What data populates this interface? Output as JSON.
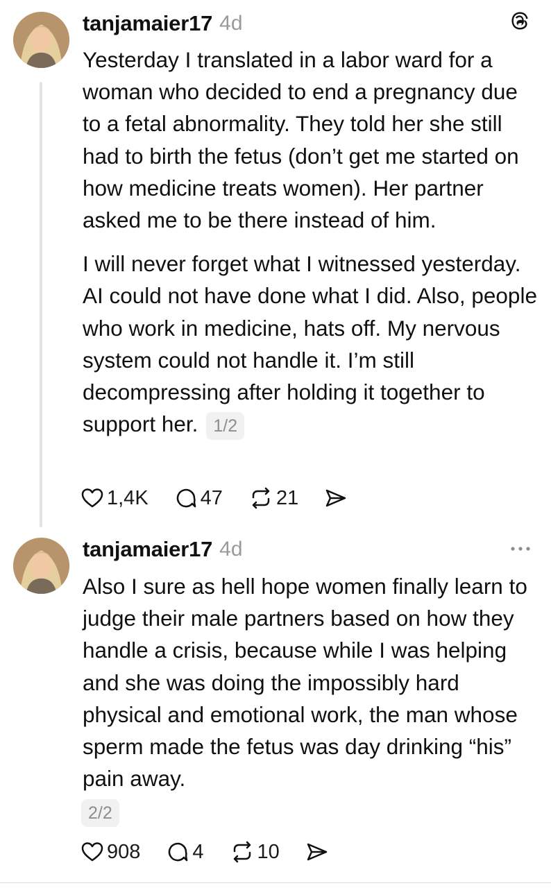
{
  "posts": [
    {
      "username": "tanjamaier17",
      "time": "4d",
      "paragraphs": [
        "Yesterday I translated in a labor ward for a woman who decided to end a pregnancy due to a fetal abnormality. They told her she still had to birth the fetus (don’t get me started on how medicine treats women). Her partner asked me to be there instead of him.",
        "I will never forget what I witnessed yesterday. AI could not have done what I did. Also, people who work in medicine, hats off. My nervous system could not handle it. I’m still decompressing after holding it together to support her."
      ],
      "page": "1/2",
      "likes": "1,4K",
      "replies": "47",
      "reposts": "21",
      "header_icon": "threads-logo-icon"
    },
    {
      "username": "tanjamaier17",
      "time": "4d",
      "paragraphs": [
        "Also I sure as hell hope women finally learn to judge their male partners based on how they handle a crisis, because while I was helping and she was doing the impossibly hard physical and emotional work, the man whose sperm made the fetus was day drinking “his” pain away."
      ],
      "page": "2/2",
      "likes": "908",
      "replies": "4",
      "reposts": "10",
      "header_icon": "more-options-icon"
    }
  ],
  "colors": {
    "text": "#101010",
    "muted": "#9a9a9a",
    "badge_bg": "#f1f1f1",
    "thread_line": "#e3e3e3"
  }
}
